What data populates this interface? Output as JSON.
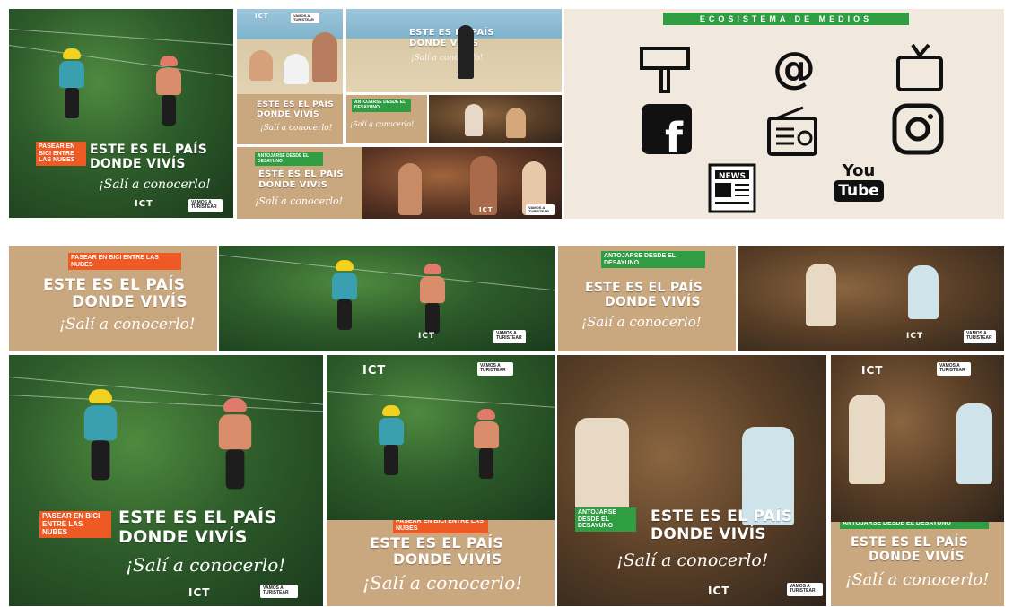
{
  "campaign": {
    "headline_line1": "ESTE ES EL PAÍS",
    "headline_line2": "DONDE VIVÍS",
    "tagline": "¡Salí a conocerlo!"
  },
  "tags": {
    "zipline": "PASEAR EN BICI ENTRE LAS NUBES",
    "breakfast": "ANTOJARSE DESDE EL DESAYUNO"
  },
  "logos": {
    "ict": "ICT",
    "partner": "VAMOS A TURISTEAR"
  },
  "media_ecosystem": {
    "title": "ECOSISTEMA DE MEDIOS",
    "icons": [
      "billboard-icon",
      "at-icon",
      "tv-icon",
      "facebook-icon",
      "radio-icon",
      "instagram-icon",
      "newspaper-icon",
      "youtube-icon"
    ],
    "at_symbol": "@",
    "facebook_letter": "f",
    "news_label": "NEWS",
    "youtube_you": "You",
    "youtube_tube": "Tube"
  },
  "colors": {
    "kraft": "#c9a77f",
    "green": "#2f9e43",
    "orange": "#ef5a24",
    "media_bg": "#f1e8de"
  }
}
